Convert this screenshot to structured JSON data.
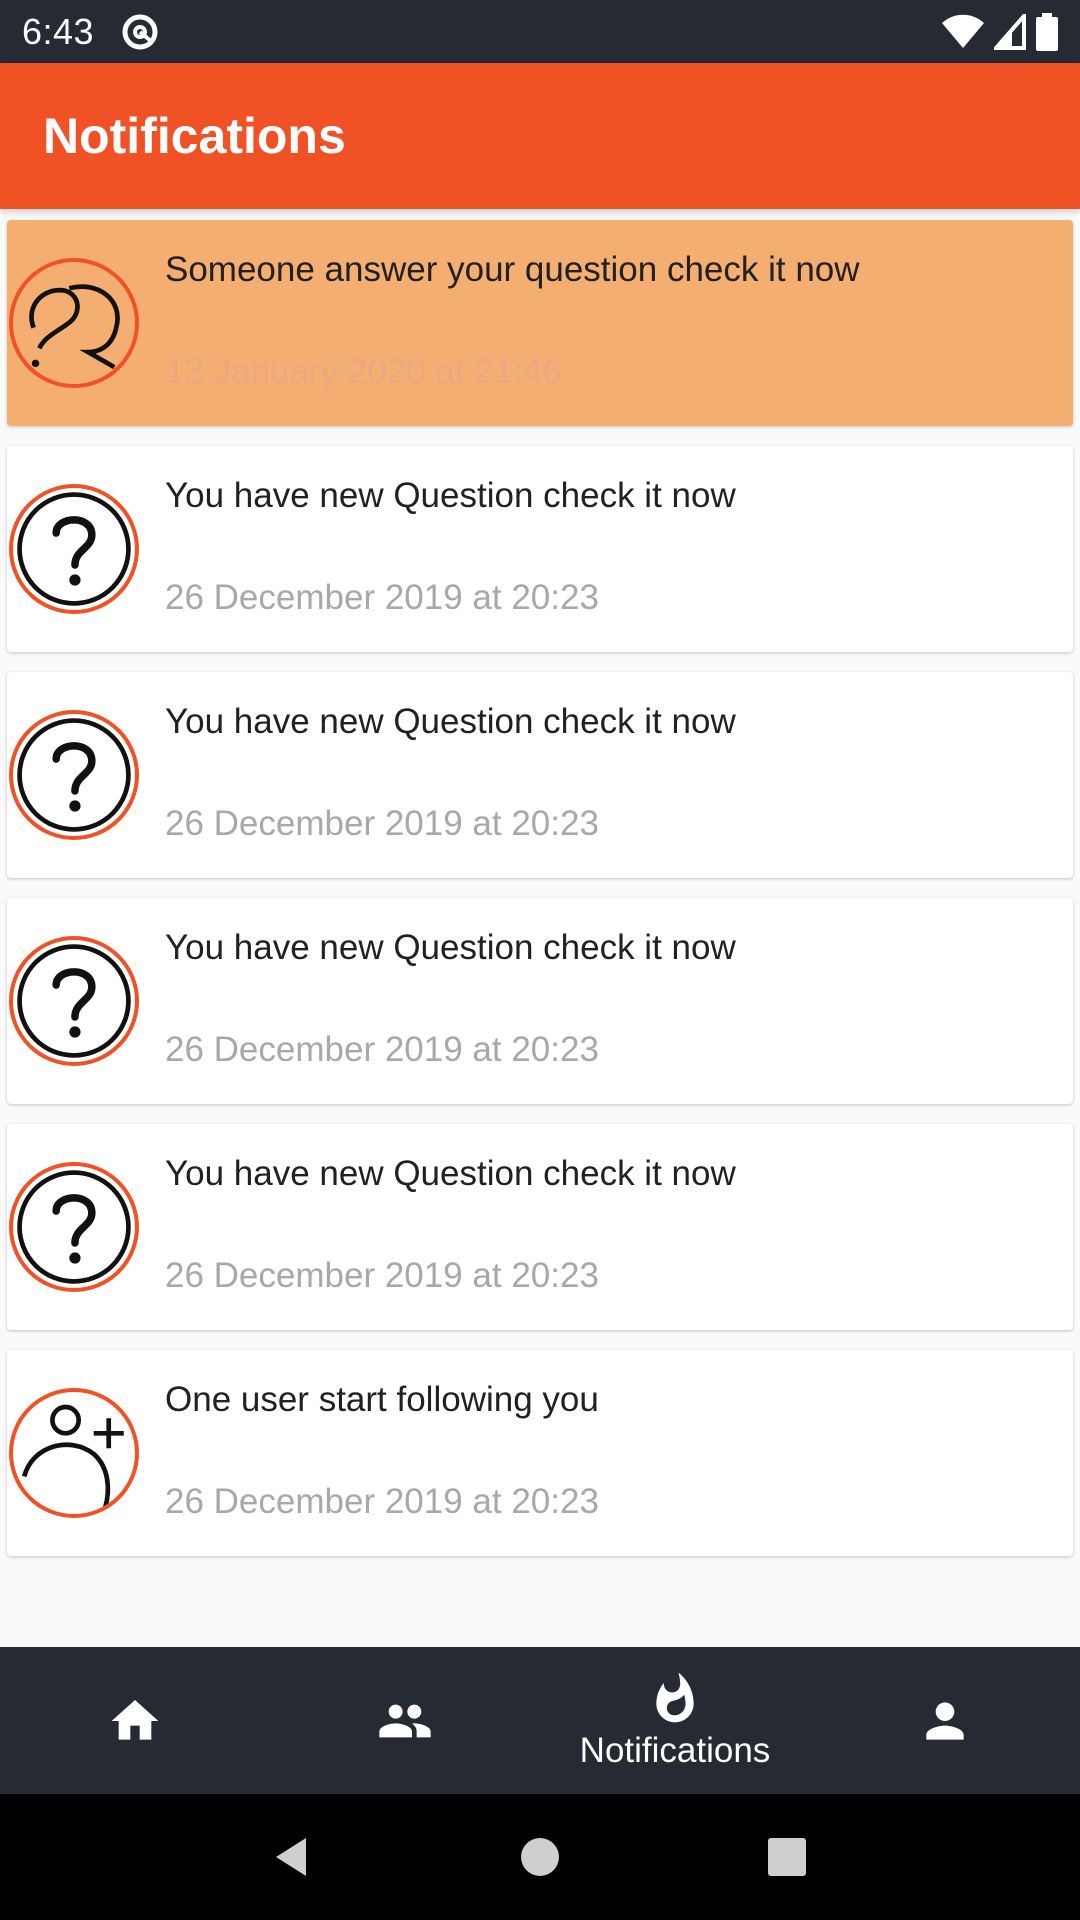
{
  "status_bar": {
    "time": "6:43"
  },
  "app_bar": {
    "title": "Notifications"
  },
  "notifications": [
    {
      "icon": "chat-question-icon",
      "message": "Someone answer your question check it now",
      "timestamp": "13 January 2020 at 21:46",
      "highlighted": true
    },
    {
      "icon": "question-mark-icon",
      "message": "You have new Question check it now",
      "timestamp": "26 December 2019 at 20:23",
      "highlighted": false
    },
    {
      "icon": "question-mark-icon",
      "message": "You have new Question check it now",
      "timestamp": "26 December 2019 at 20:23",
      "highlighted": false
    },
    {
      "icon": "question-mark-icon",
      "message": "You have new Question check it now",
      "timestamp": "26 December 2019 at 20:23",
      "highlighted": false
    },
    {
      "icon": "question-mark-icon",
      "message": "You have new Question check it now",
      "timestamp": "26 December 2019 at 20:23",
      "highlighted": false
    },
    {
      "icon": "add-user-icon",
      "message": "One user start following you",
      "timestamp": "26 December 2019 at 20:23",
      "highlighted": false
    }
  ],
  "bottom_nav": {
    "items": [
      {
        "icon": "home-icon",
        "label": ""
      },
      {
        "icon": "people-icon",
        "label": ""
      },
      {
        "icon": "flame-icon",
        "label": "Notifications",
        "active": true
      },
      {
        "icon": "person-icon",
        "label": ""
      }
    ]
  },
  "colors": {
    "accent": "#f05125",
    "highlight": "#f5ae72",
    "dark": "#262a33",
    "timestamp": "#a8a8a8"
  }
}
